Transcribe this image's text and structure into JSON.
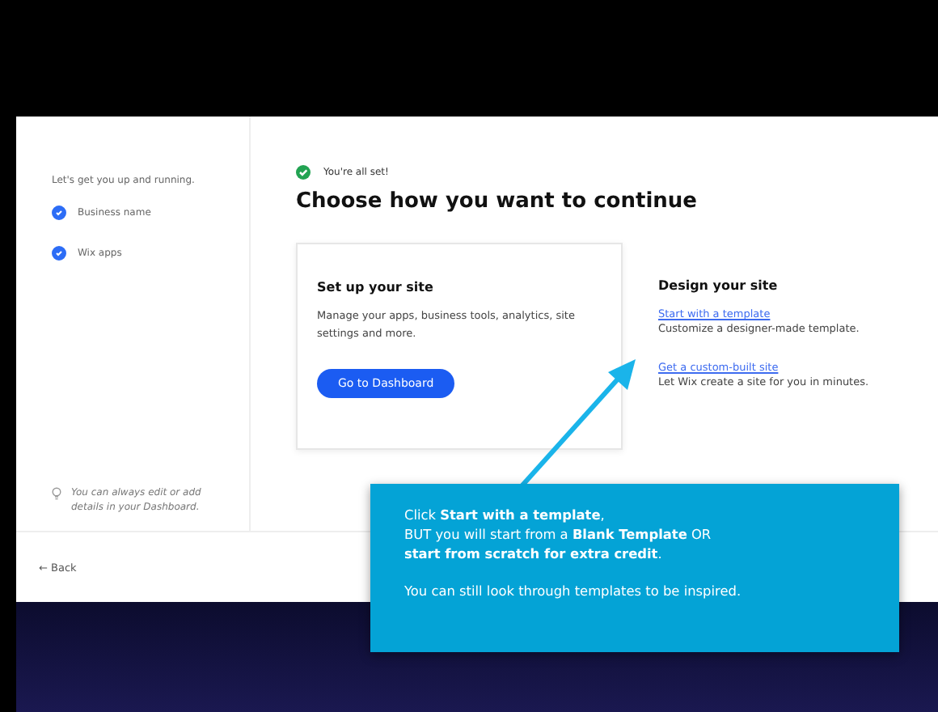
{
  "sidebar": {
    "intro": "Let's get you up and running.",
    "steps": [
      {
        "label": "Business name",
        "checked": true
      },
      {
        "label": "Wix apps",
        "checked": true
      }
    ],
    "tip": "You can always edit or add details in your Dashboard."
  },
  "status": "You're all set!",
  "heading": "Choose how you want to continue",
  "setup_card": {
    "title": "Set up your site",
    "description": "Manage your apps, business tools, analytics, site settings and more.",
    "button": "Go to Dashboard"
  },
  "design": {
    "title": "Design your site",
    "options": [
      {
        "link": "Start with a template",
        "description": "Customize a designer-made template."
      },
      {
        "link": "Get a custom-built site",
        "description": "Let Wix create a site for you in minutes."
      }
    ]
  },
  "back": "← Back",
  "callout": {
    "lines": [
      "Click **Start with a template**,",
      "BUT you will start from a **Blank Template** OR",
      "**start from scratch for extra credit**."
    ],
    "note": "You can still look through templates to be inspired."
  }
}
